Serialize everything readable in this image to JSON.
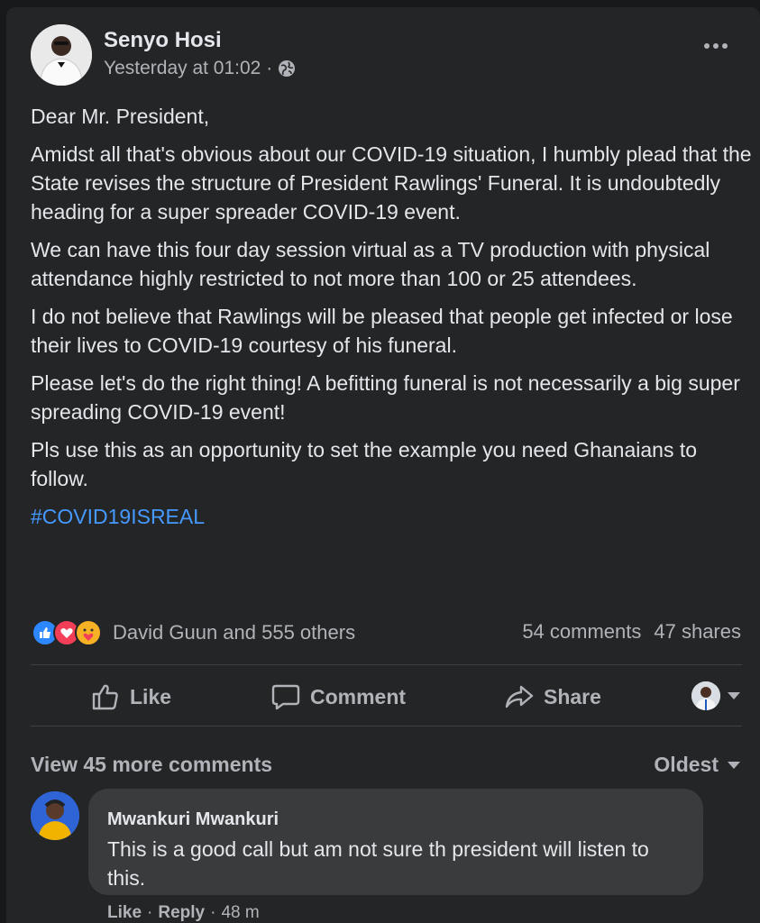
{
  "post": {
    "author": "Senyo Hosi",
    "timestamp": "Yesterday at 01:02 ·",
    "privacy_icon": "globe-icon",
    "paragraphs": [
      "Dear Mr. President,",
      "Amidst all that's obvious about our COVID-19 situation, I humbly plead that the State revises the structure of President Rawlings' Funeral. It is undoubtedly heading for a super spreader COVID-19 event.",
      "We can have this four day session virtual as a TV production with physical attendance highly restricted to not more than 100 or 25 attendees.",
      "I do not believe that Rawlings will be pleased that people get infected or lose their lives to COVID-19 courtesy of his funeral.",
      "Please let's do the right thing! A befitting funeral is not necessarily a big super spreading COVID-19 event!",
      "Pls use this as an opportunity to set the example you need Ghanaians to follow."
    ],
    "hashtag": "#COVID19ISREAL"
  },
  "reactions": {
    "icons": [
      "like-reaction-icon",
      "love-reaction-icon",
      "care-reaction-icon"
    ],
    "names": "David Guun and 555 others",
    "comments": "54 comments",
    "shares": "47 shares"
  },
  "actions": {
    "like": "Like",
    "comment": "Comment",
    "share": "Share"
  },
  "comments_section": {
    "view_more": "View 45 more comments",
    "sort": "Oldest",
    "comment": {
      "name": "Mwankuri Mwankuri",
      "text": "This is a good call but am not sure th president will listen to this.",
      "like": "Like",
      "sep1": "·",
      "reply": "Reply",
      "sep2": "·",
      "time": "48 m"
    }
  },
  "colors": {
    "background": "#18191a",
    "card": "#242526",
    "bubble": "#3a3b3c",
    "link": "#4599ff",
    "like_blue": "#2d88ff",
    "love_red": "#f33e58",
    "care_yellow": "#f7b125"
  }
}
